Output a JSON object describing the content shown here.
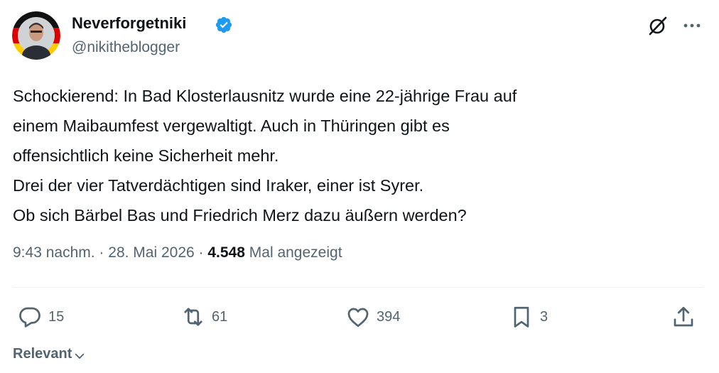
{
  "author": {
    "display_name": "Neverforgetniki",
    "handle": "@nikitheblogger",
    "verified": true
  },
  "tweet": {
    "lines": [
      "Schockierend: In Bad Klosterlausnitz wurde eine 22-jährige Frau auf",
      "einem Maibaumfest vergewaltigt. Auch in Thüringen gibt es",
      "offensichtlich keine Sicherheit mehr.",
      "Drei der vier Tatverdächtigen sind Iraker, einer ist Syrer.",
      "Ob sich Bärbel Bas und Friedrich Merz dazu äußern werden?"
    ]
  },
  "meta": {
    "time": "9:43 nachm.",
    "separator": "·",
    "date": "28. Mai 2026",
    "views_count": "4.548",
    "views_label": "Mal angezeigt"
  },
  "actions": {
    "replies": "15",
    "reposts": "61",
    "likes": "394",
    "bookmarks": "3"
  },
  "sort": {
    "label": "Relevant"
  },
  "icons": {
    "verified": "verified-badge-icon",
    "grok": "grok-icon",
    "more": "more-icon",
    "reply": "reply-icon",
    "repost": "repost-icon",
    "like": "heart-icon",
    "bookmark": "bookmark-icon",
    "share": "share-icon",
    "chevron": "chevron-down-icon"
  },
  "colors": {
    "text": "#0f1419",
    "secondary": "#536471",
    "verified": "#1d9bf0",
    "divider": "#eff3f4"
  }
}
